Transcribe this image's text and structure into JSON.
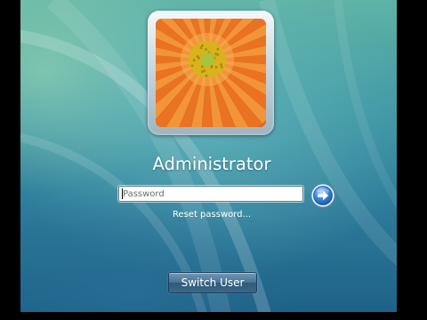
{
  "user": {
    "name": "Administrator",
    "picture_icon": "orange-flower-icon"
  },
  "password": {
    "value": "",
    "placeholder": "Password"
  },
  "submit": {
    "icon": "arrow-right-icon"
  },
  "reset_link_label": "Reset password...",
  "switch_user_label": "Switch User",
  "colors": {
    "background": "#3f96a4",
    "submit_button": "#2f7fd0",
    "switch_button": "#4b7596"
  }
}
